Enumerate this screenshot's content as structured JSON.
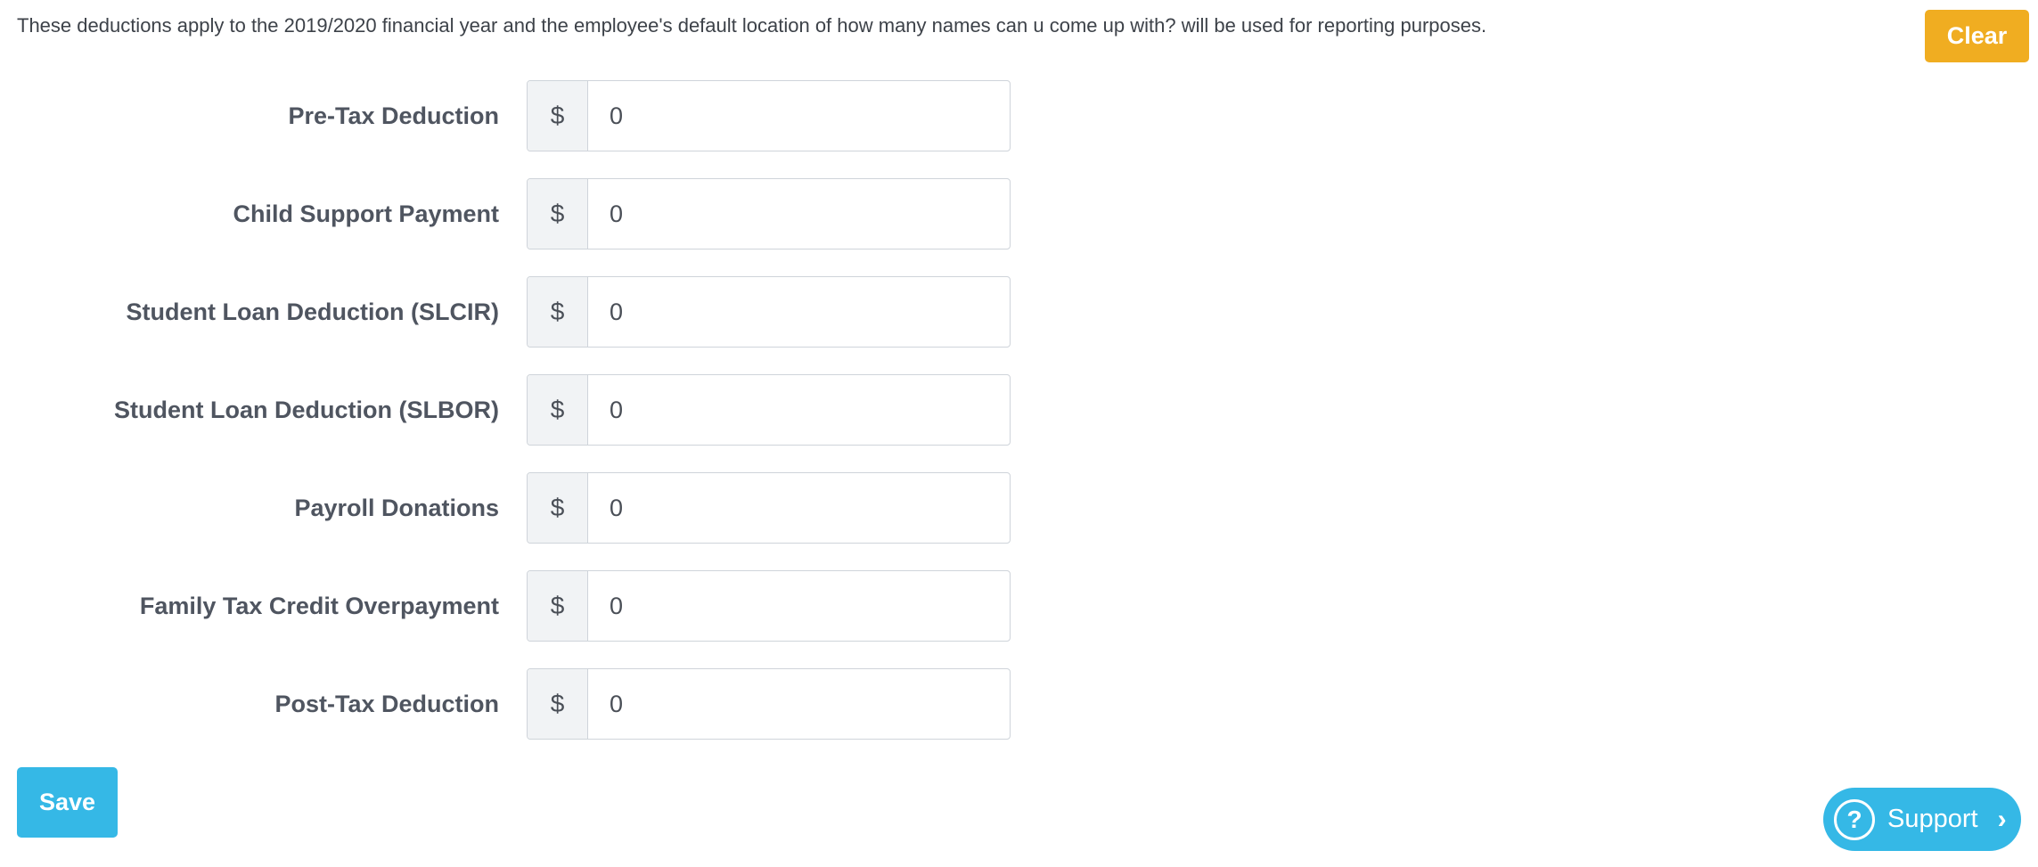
{
  "notice": {
    "text": "These deductions apply to the 2019/2020 financial year and the employee's default location of how many names can u come up with? will be used for reporting purposes."
  },
  "actions": {
    "clear_label": "Clear",
    "save_label": "Save"
  },
  "currency_symbol": "$",
  "fields": [
    {
      "label": "Pre-Tax Deduction",
      "value": "0"
    },
    {
      "label": "Child Support Payment",
      "value": "0"
    },
    {
      "label": "Student Loan Deduction (SLCIR)",
      "value": "0"
    },
    {
      "label": "Student Loan Deduction (SLBOR)",
      "value": "0"
    },
    {
      "label": "Payroll Donations",
      "value": "0"
    },
    {
      "label": "Family Tax Credit Overpayment",
      "value": "0"
    },
    {
      "label": "Post-Tax Deduction",
      "value": "0"
    }
  ],
  "support": {
    "label": "Support",
    "icon": "question-circle-icon",
    "chevron": "chevron-right-icon"
  },
  "colors": {
    "clear_button": "#f0ad21",
    "primary": "#35b8e6"
  }
}
